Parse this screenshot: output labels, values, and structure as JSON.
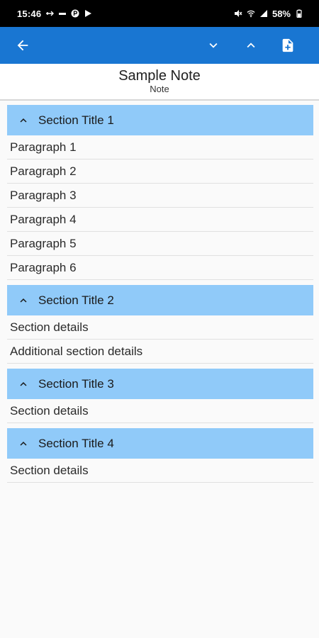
{
  "status_bar": {
    "time": "15:46",
    "battery": "58%"
  },
  "app_bar": {
    "icons": {
      "back": "arrow-back-icon",
      "down": "chevron-down-icon",
      "up": "chevron-up-icon",
      "add": "note-add-icon"
    },
    "color": "#1976d2"
  },
  "note": {
    "title": "Sample Note",
    "subtitle": "Note"
  },
  "colors": {
    "section_header": "#90caf9"
  },
  "sections": [
    {
      "title": "Section Title 1",
      "items": [
        "Paragraph 1",
        "Paragraph 2",
        "Paragraph 3",
        "Paragraph 4",
        "Paragraph 5",
        "Paragraph 6"
      ]
    },
    {
      "title": "Section Title 2",
      "items": [
        "Section details",
        "Additional section details"
      ]
    },
    {
      "title": "Section Title 3",
      "items": [
        "Section details"
      ]
    },
    {
      "title": "Section Title 4",
      "items": [
        "Section details"
      ]
    }
  ]
}
